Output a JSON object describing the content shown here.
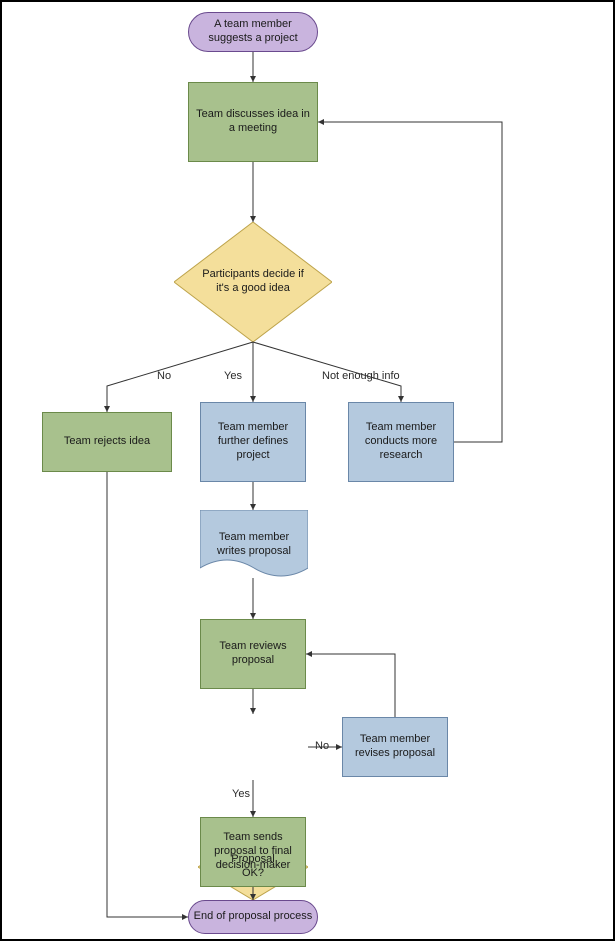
{
  "nodes": {
    "start": {
      "text": "A team member suggests a project"
    },
    "discuss": {
      "text": "Team discusses idea in a meeting"
    },
    "decide": {
      "text": "Participants decide if it's a good idea"
    },
    "reject": {
      "text": "Team rejects idea"
    },
    "define": {
      "text": "Team member further defines project"
    },
    "research": {
      "text": "Team member conducts more research"
    },
    "proposal": {
      "text": "Team member writes proposal"
    },
    "review": {
      "text": "Team reviews proposal"
    },
    "proposal_ok": {
      "text": "Proposal OK?"
    },
    "revise": {
      "text": "Team member revises proposal"
    },
    "send": {
      "text": "Team sends proposal to final decision-maker"
    },
    "end": {
      "text": "End of proposal process"
    }
  },
  "edge_labels": {
    "no": "No",
    "yes": "Yes",
    "not_enough": "Not enough info",
    "ok_no": "No",
    "ok_yes": "Yes"
  },
  "chart_data": {
    "type": "flowchart",
    "nodes": [
      {
        "id": "start",
        "shape": "terminator",
        "text": "A team member suggests a project"
      },
      {
        "id": "discuss",
        "shape": "process",
        "text": "Team discusses idea in a meeting"
      },
      {
        "id": "decide",
        "shape": "decision",
        "text": "Participants decide if it's a good idea"
      },
      {
        "id": "reject",
        "shape": "process",
        "text": "Team rejects idea"
      },
      {
        "id": "define",
        "shape": "process",
        "text": "Team member further defines project"
      },
      {
        "id": "research",
        "shape": "process",
        "text": "Team member conducts more research"
      },
      {
        "id": "proposal",
        "shape": "document",
        "text": "Team member writes proposal"
      },
      {
        "id": "review",
        "shape": "process",
        "text": "Team reviews proposal"
      },
      {
        "id": "proposal_ok",
        "shape": "decision",
        "text": "Proposal OK?"
      },
      {
        "id": "revise",
        "shape": "process",
        "text": "Team member revises proposal"
      },
      {
        "id": "send",
        "shape": "process",
        "text": "Team sends proposal to final decision-maker"
      },
      {
        "id": "end",
        "shape": "terminator",
        "text": "End of proposal process"
      }
    ],
    "edges": [
      {
        "from": "start",
        "to": "discuss"
      },
      {
        "from": "discuss",
        "to": "decide"
      },
      {
        "from": "decide",
        "to": "reject",
        "label": "No"
      },
      {
        "from": "decide",
        "to": "define",
        "label": "Yes"
      },
      {
        "from": "decide",
        "to": "research",
        "label": "Not enough info"
      },
      {
        "from": "research",
        "to": "discuss"
      },
      {
        "from": "define",
        "to": "proposal"
      },
      {
        "from": "proposal",
        "to": "review"
      },
      {
        "from": "review",
        "to": "proposal_ok"
      },
      {
        "from": "proposal_ok",
        "to": "revise",
        "label": "No"
      },
      {
        "from": "revise",
        "to": "review"
      },
      {
        "from": "proposal_ok",
        "to": "send",
        "label": "Yes"
      },
      {
        "from": "send",
        "to": "end"
      },
      {
        "from": "reject",
        "to": "end"
      }
    ]
  }
}
